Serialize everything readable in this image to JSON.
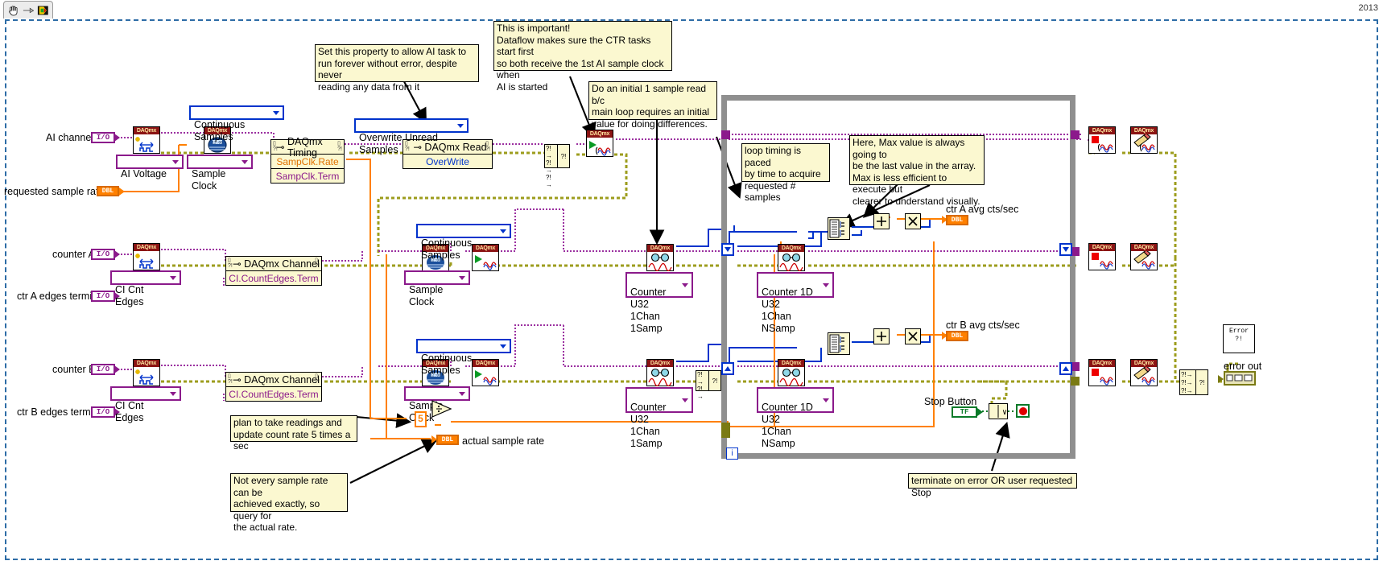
{
  "window": {
    "year_label": "2013",
    "toolbar_icons": [
      "hand-tool-icon",
      "arrow-tool-icon",
      "run-arrow-icon"
    ]
  },
  "controls": {
    "ai_channels": {
      "label": "AI channels",
      "type": "I/O"
    },
    "requested_sample_rate": {
      "label": "requested sample rate",
      "type": "DBL"
    },
    "counter_a": {
      "label": "counter A",
      "type": "I/O"
    },
    "ctr_a_edges_terminal": {
      "label": "ctr A edges terminal",
      "type": "I/O"
    },
    "counter_b": {
      "label": "counter B",
      "type": "I/O"
    },
    "ctr_b_edges_terminal": {
      "label": "ctr B edges terminal",
      "type": "I/O"
    },
    "stop_button": {
      "label": "Stop Button",
      "type": "TF"
    }
  },
  "indicators": {
    "ctr_a_avg": {
      "label": "ctr A avg cts/sec",
      "type": "DBL"
    },
    "ctr_b_avg": {
      "label": "ctr B avg cts/sec",
      "type": "DBL"
    },
    "actual_sample_rate": {
      "label": "actual sample rate",
      "type": "DBL"
    },
    "error_out": {
      "label": "error out"
    }
  },
  "constants": {
    "ai_voltage": "AI Voltage",
    "sample_clock_ai": "Sample Clock",
    "continuous_samples_ai": "Continuous Samples",
    "overwrite_unread_samples": "Overwrite Unread Samples",
    "ci_cnt_edges_a": "CI Cnt Edges",
    "sample_clock_a": "Sample Clock",
    "continuous_samples_a": "Continuous Samples",
    "ci_cnt_edges_b": "CI Cnt Edges",
    "sample_clock_b": "Sample Clock",
    "continuous_samples_b": "Continuous Samples",
    "counter_u32_1chan_1samp_a": "Counter U32\n1Chan 1Samp",
    "counter_u32_1chan_1samp_b": "Counter U32\n1Chan 1Samp",
    "counter_1d_u32_1chan_nsamp_a": "Counter 1D U32\n1Chan NSamp",
    "counter_1d_u32_1chan_nsamp_b": "Counter 1D U32\n1Chan NSamp",
    "updates_per_sec": "5"
  },
  "property_nodes": {
    "daqmx_timing": {
      "title": "DAQmx Timing",
      "properties": [
        "SampClk.Rate",
        "SampClk.Term"
      ]
    },
    "daqmx_read": {
      "title": "DAQmx Read",
      "properties": [
        "OverWrite"
      ]
    },
    "daqmx_channel_a": {
      "title": "DAQmx Channel",
      "properties": [
        "CI.CountEdges.Term"
      ]
    },
    "daqmx_channel_b": {
      "title": "DAQmx Channel",
      "properties": [
        "CI.CountEdges.Term"
      ]
    }
  },
  "vis": {
    "daqmx_create_channel": "DAQmx",
    "daqmx_timing": "DAQmx",
    "daqmx_start": "DAQmx",
    "daqmx_read": "DAQmx",
    "daqmx_stop": "DAQmx",
    "daqmx_clear": "DAQmx"
  },
  "notes": [
    {
      "id": "note-ai-overwrite",
      "text": "Set this property to allow AI task to\nrun forever without error, despite never\nreading any data from it"
    },
    {
      "id": "note-dataflow",
      "text": "This is important!\nDataflow makes sure the CTR tasks start first\nso both receive the 1st AI sample clock when\nAI is started"
    },
    {
      "id": "note-initial-read",
      "text": "Do an initial 1 sample read b/c\nmain loop requires an initial\nvalue for doing differences."
    },
    {
      "id": "note-loop-timing",
      "text": "loop timing is paced\nby time to acquire\nrequested # samples"
    },
    {
      "id": "note-max-value",
      "text": "Here, Max value is always going to\nbe the last value in the array.\nMax is less efficient to execute but\nclearer to understand visually."
    },
    {
      "id": "note-five-times",
      "text": "plan to take readings and\nupdate count rate 5 times a sec"
    },
    {
      "id": "note-actual-rate",
      "text": "Not every sample rate can be\nachieved exactly, so query for\nthe actual rate."
    },
    {
      "id": "note-terminate",
      "text": "terminate on error OR user requested Stop"
    }
  ],
  "loop": {
    "iteration_label": "i"
  },
  "colors": {
    "wire_error": "#9d9d1e",
    "wire_daq_task": "#9b30a0",
    "wire_dbl": "#ff8000",
    "wire_u32": "#0033cc",
    "wire_bool": "#0a7a29",
    "note_bg": "#fbf8d0",
    "loop_border": "#8f8f8f",
    "frame_border": "#2d6ca6"
  }
}
